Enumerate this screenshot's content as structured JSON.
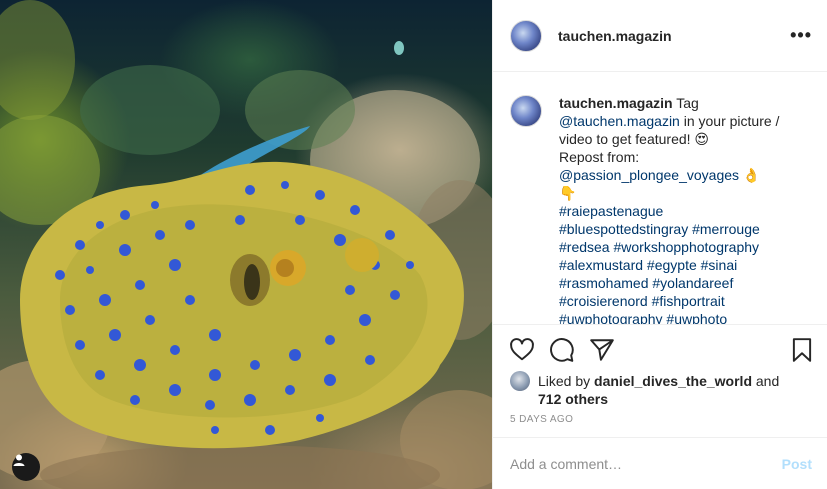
{
  "post": {
    "username": "tauchen.magazin",
    "more_icon": "ellipsis-icon",
    "caption": {
      "username": "tauchen.magazin",
      "intro_text": " Tag",
      "mention_1": "@tauchen.magazin",
      "after_mention": " in your picture / video to get featured! 😍",
      "repost_label": "Repost from:",
      "mention_2": "@passion_plongee_voyages",
      "after_mention_2": " 👌",
      "pointing_emoji": "👇",
      "hashtag_lines": [
        "#raiepastenague",
        "#bluespottedstingray #merrouge",
        "#redsea #workshopphotography",
        "#alexmustard #egypte #sinai",
        "#rasmohamed #yolandareef",
        "#croisierenord #fishportrait",
        "#uwphotography #uwphoto"
      ]
    },
    "likes": {
      "prefix": "Liked by ",
      "user": "daniel_dives_the_world",
      "middle": " and",
      "others": "712 others"
    },
    "timestamp": "5 DAYS AGO",
    "comment": {
      "placeholder": "Add a comment…",
      "post_label": "Post"
    }
  },
  "colors": {
    "link": "#00376b",
    "post_disabled": "#b2dffc",
    "muted": "#8e8e8e",
    "text": "#262626"
  }
}
